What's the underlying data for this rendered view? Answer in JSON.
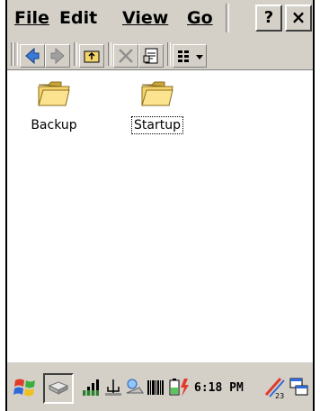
{
  "menubar": {
    "items": [
      {
        "label": "File"
      },
      {
        "label": "Edit"
      },
      {
        "label": "View"
      },
      {
        "label": "Go"
      }
    ],
    "help_label": "?",
    "close_label": "×"
  },
  "toolbar": {
    "buttons": [
      "back",
      "forward",
      "up-folder",
      "delete",
      "properties",
      "view-menu"
    ]
  },
  "files": [
    {
      "name": "Backup",
      "icon": "folder-icon",
      "selected": false
    },
    {
      "name": "Startup",
      "icon": "folder-icon",
      "selected": true
    }
  ],
  "taskbar": {
    "time": "6:18 PM"
  },
  "colors": {
    "chrome": "#d4d0c8",
    "folder": "#f5d56b",
    "folder_dark": "#c9a53a",
    "arrow_blue": "#3a7bd5"
  }
}
